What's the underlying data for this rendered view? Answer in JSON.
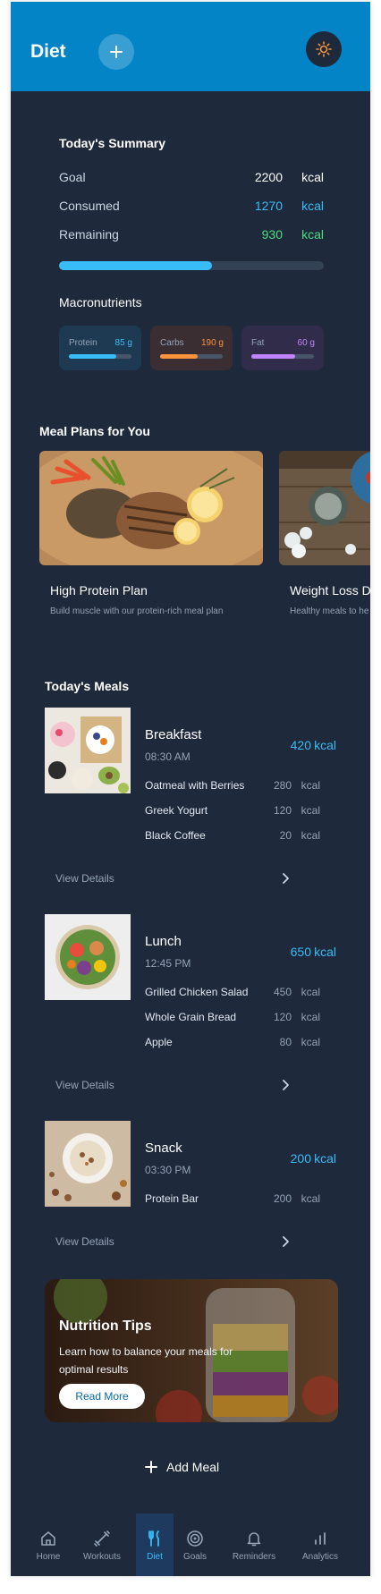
{
  "header": {
    "title": "Diet"
  },
  "summary": {
    "title": "Today's Summary",
    "rows": [
      {
        "label": "Goal",
        "value": "2200",
        "unit": "kcal",
        "color": "#ffffff"
      },
      {
        "label": "Consumed",
        "value": "1270",
        "unit": "kcal",
        "color": "#38bdf8"
      },
      {
        "label": "Remaining",
        "value": "930",
        "unit": "kcal",
        "color": "#4ade80"
      }
    ],
    "progress": 0.577,
    "macros_title": "Macronutrients",
    "macros": [
      {
        "label": "Protein",
        "value": "85 g",
        "fill": 0.75,
        "color": "#38bdf8",
        "bg": "#1e3a52"
      },
      {
        "label": "Carbs",
        "value": "190 g",
        "fill": 0.6,
        "color": "#fb923c",
        "bg": "#3a2e33"
      },
      {
        "label": "Fat",
        "value": "60 g",
        "fill": 0.7,
        "color": "#c084fc",
        "bg": "#312c4a"
      }
    ]
  },
  "plans": {
    "title": "Meal Plans for You",
    "items": [
      {
        "name": "High Protein Plan",
        "desc": "Build muscle with our protein-rich meal plan"
      },
      {
        "name": "Weight Loss D",
        "desc": "Healthy meals to he goals"
      }
    ]
  },
  "meals": {
    "title": "Today's Meals",
    "view_label": "View Details",
    "list": [
      {
        "name": "Breakfast",
        "time": "08:30 AM",
        "kcal": "420",
        "unit": "kcal",
        "items": [
          {
            "name": "Oatmeal with Berries",
            "kcal": "280",
            "unit": "kcal"
          },
          {
            "name": "Greek Yogurt",
            "kcal": "120",
            "unit": "kcal"
          },
          {
            "name": "Black Coffee",
            "kcal": "20",
            "unit": "kcal"
          }
        ]
      },
      {
        "name": "Lunch",
        "time": "12:45 PM",
        "kcal": "650",
        "unit": "kcal",
        "items": [
          {
            "name": "Grilled Chicken Salad",
            "kcal": "450",
            "unit": "kcal"
          },
          {
            "name": "Whole Grain Bread",
            "kcal": "120",
            "unit": "kcal"
          },
          {
            "name": "Apple",
            "kcal": "80",
            "unit": "kcal"
          }
        ]
      },
      {
        "name": "Snack",
        "time": "03:30 PM",
        "kcal": "200",
        "unit": "kcal",
        "items": [
          {
            "name": "Protein Bar",
            "kcal": "200",
            "unit": "kcal"
          }
        ]
      }
    ]
  },
  "tips": {
    "title": "Nutrition Tips",
    "text": "Learn how to balance your meals for optimal results",
    "button": "Read More"
  },
  "add_meal": "Add Meal",
  "nav": [
    {
      "label": "Home",
      "icon": "home-icon",
      "active": false
    },
    {
      "label": "Workouts",
      "icon": "dumbbell-icon",
      "active": false
    },
    {
      "label": "Diet",
      "icon": "utensils-icon",
      "active": true
    },
    {
      "label": "Goals",
      "icon": "target-icon",
      "active": false
    },
    {
      "label": "Reminders",
      "icon": "bell-icon",
      "active": false
    },
    {
      "label": "Analytics",
      "icon": "chart-icon",
      "active": false
    }
  ]
}
